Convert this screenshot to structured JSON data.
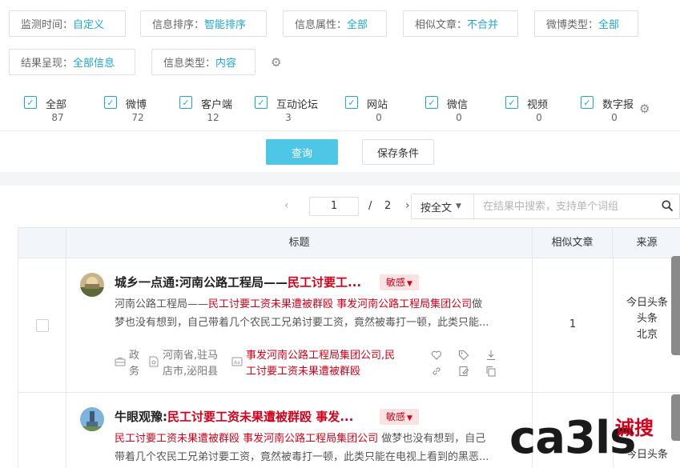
{
  "filters": [
    {
      "label": "监测时间：",
      "value": "自定义"
    },
    {
      "label": "信息排序：",
      "value": "智能排序"
    },
    {
      "label": "信息属性：",
      "value": "全部"
    },
    {
      "label": "相似文章：",
      "value": "不合并"
    },
    {
      "label": "微博类型：",
      "value": "全部"
    },
    {
      "label": "结果呈现：",
      "value": "全部信息"
    },
    {
      "label": "信息类型：",
      "value": "内容"
    }
  ],
  "types": [
    {
      "name": "全部",
      "count": "87"
    },
    {
      "name": "微博",
      "count": "72"
    },
    {
      "name": "客户端",
      "count": "12"
    },
    {
      "name": "互动论坛",
      "count": "3"
    },
    {
      "name": "网站",
      "count": "0"
    },
    {
      "name": "微信",
      "count": "0"
    },
    {
      "name": "视频",
      "count": "0"
    },
    {
      "name": "数字报",
      "count": "0"
    }
  ],
  "actions": {
    "query": "查询",
    "save": "保存条件"
  },
  "pager": {
    "current": "1",
    "separator": "/",
    "total": "2",
    "prev": "‹",
    "next": "›"
  },
  "search": {
    "scope": "按全文",
    "placeholder": "在结果中搜索，支持单个词组"
  },
  "table": {
    "headers": {
      "title": "标题",
      "similar": "相似文章",
      "source": "来源"
    }
  },
  "rows": [
    {
      "title_prefix": "城乡一点通:河南公路工程局——",
      "title_highlight": "民工讨要工...",
      "badge": "敏感",
      "summary_line1_pre": "河南公路工程局——",
      "summary_line1_hl": "民工讨要工资未果遭被群殴 事发河南公路工程局集团公司",
      "summary_line1_post": "做",
      "summary_line2": "梦也没有想到，自己带着几个农民工兄弟讨要工资，竟然被毒打一顿，此类只能...",
      "category_line1": "政",
      "category_line2": "务",
      "location_line1": "河南省,驻马",
      "location_line2": "店市,泌阳县",
      "keywords_line1": "事发河南公路工程局集团公司,民",
      "keywords_line2": "工讨要工资未果遭被群殴",
      "similar": "1",
      "source_line1": "今日头条",
      "source_line2": "头条",
      "source_line3": "北京"
    },
    {
      "title_prefix": "牛眼观豫:",
      "title_highlight": "民工讨要工资未果遭被群殴 事发...",
      "badge": "敏感",
      "summary_line1_hl": "民工讨要工资未果遭被群殴 事发河南公路工程局集团公司",
      "summary_line1_post": " 做梦也没有想到，自己",
      "summary_line2": "带着几个农民工兄弟讨要工资，竟然被毒打一顿，此类只能在电视上看到的黑恶...",
      "source_line1": "今日头条"
    }
  ],
  "watermark": {
    "logo": "ca3ls",
    "cn": "诚搜"
  },
  "colors": {
    "accent": "#1fa7d4",
    "primary_button": "#4ec6e6",
    "highlight": "#d0021b",
    "badge_bg": "#fde2e2",
    "header_bg": "#f2f5f9"
  }
}
